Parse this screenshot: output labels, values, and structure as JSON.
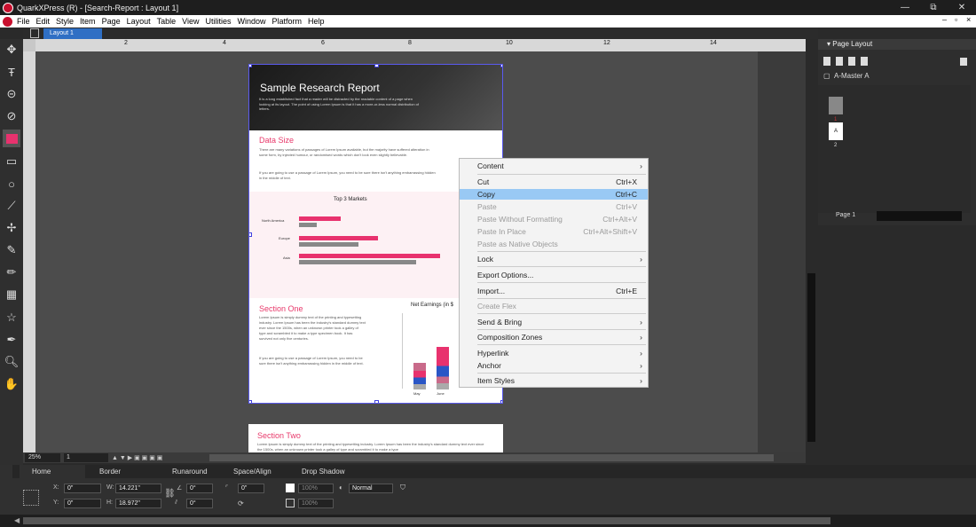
{
  "window": {
    "title": "QuarkXPress (R) - [Search-Report : Layout 1]",
    "minimize": "—",
    "restore": "⧉",
    "close": "✕"
  },
  "menubar": {
    "items": [
      "File",
      "Edit",
      "Style",
      "Item",
      "Page",
      "Layout",
      "Table",
      "View",
      "Utilities",
      "Window",
      "Platform",
      "Help"
    ],
    "doc_minimize": "–",
    "doc_restore": "▫",
    "doc_close": "×"
  },
  "layout_tab": {
    "label": "Layout 1"
  },
  "ruler": {
    "labels": [
      "2",
      "4",
      "6",
      "8",
      "10",
      "12",
      "14"
    ]
  },
  "page": {
    "hero_title": "Sample Research Report",
    "hero_text": "It is a long established fact that a reader will be distracted by the readable content of a page when looking at its layout. The point of using Lorem Ipsum is that it has a more-or-less normal distribution of letters.",
    "data_size_title": "Data Size",
    "data_size_text": "There are many variations of passages of Lorem Ipsum available, but the majority have suffered alteration in some form, by injected humour, or randomised words which don't look even slightly believable.",
    "data_size_text2": "If you are going to use a passage of Lorem Ipsum, you need to be sure there isn't anything embarrassing hidden in the middle of text.",
    "section_one_title": "Section One",
    "section_one_text": "Lorem Ipsum is simply dummy text of the printing and typesetting industry. Lorem Ipsum has been the industry's standard dummy text ever since the 1500s, when an unknown printer took a galley of type and scrambled it to make a type specimen book. It has survived not only five centuries.",
    "section_one_text2": "If you are going to use a passage of Lorem Ipsum, you need to be sure there isn't anything embarrassing hidden in the middle of text.",
    "section_two_title": "Section Two",
    "section_two_text": "Lorem Ipsum is simply dummy text of the printing and typesetting industry. Lorem Ipsum has been the industry's standard dummy text ever since the 1500s, when an unknown printer took a galley of type and scrambled it to make a type"
  },
  "chart_data": [
    {
      "type": "bar",
      "title": "Top 3 Markets",
      "categories": [
        "North America",
        "Europe",
        "Asia"
      ],
      "series": [
        {
          "values": [
            40,
            75,
            135
          ]
        },
        {
          "values": [
            17,
            57,
            112
          ]
        }
      ],
      "colors": [
        "#e8326e",
        "#888888"
      ],
      "orientation": "horizontal"
    },
    {
      "type": "bar",
      "title": "Net Earnings (in $",
      "categories": [
        "May",
        "June"
      ],
      "stacked": true,
      "colors": [
        "#e8326e",
        "#2a56c6",
        "#c96a8a",
        "#aaaaaa"
      ]
    }
  ],
  "context_menu": {
    "items": [
      {
        "label": "Content",
        "shortcut": "",
        "submenu": true,
        "disabled": false
      },
      {
        "label": "Cut",
        "shortcut": "Ctrl+X",
        "submenu": false,
        "disabled": false
      },
      {
        "label": "Copy",
        "shortcut": "Ctrl+C",
        "submenu": false,
        "disabled": false,
        "highlighted": true
      },
      {
        "label": "Paste",
        "shortcut": "Ctrl+V",
        "submenu": false,
        "disabled": true
      },
      {
        "label": "Paste Without Formatting",
        "shortcut": "Ctrl+Alt+V",
        "submenu": false,
        "disabled": true
      },
      {
        "label": "Paste In Place",
        "shortcut": "Ctrl+Alt+Shift+V",
        "submenu": false,
        "disabled": true
      },
      {
        "label": "Paste as Native Objects",
        "shortcut": "",
        "submenu": false,
        "disabled": true
      },
      {
        "label": "Lock",
        "shortcut": "",
        "submenu": true,
        "disabled": false
      },
      {
        "label": "Export Options...",
        "shortcut": "",
        "submenu": false,
        "disabled": false
      },
      {
        "label": "Import...",
        "shortcut": "Ctrl+E",
        "submenu": false,
        "disabled": false
      },
      {
        "label": "Create Flex",
        "shortcut": "",
        "submenu": false,
        "disabled": true
      },
      {
        "label": "Send & Bring",
        "shortcut": "",
        "submenu": true,
        "disabled": false
      },
      {
        "label": "Composition Zones",
        "shortcut": "",
        "submenu": true,
        "disabled": false
      },
      {
        "label": "Hyperlink",
        "shortcut": "",
        "submenu": true,
        "disabled": false
      },
      {
        "label": "Anchor",
        "shortcut": "",
        "submenu": true,
        "disabled": false
      },
      {
        "label": "Item Styles",
        "shortcut": "",
        "submenu": true,
        "disabled": false
      }
    ]
  },
  "page_layout_panel": {
    "title": "Page Layout",
    "master": "A-Master A",
    "page_label": "Page 1",
    "thumb_a": "A",
    "page_numbers": [
      "1",
      "2"
    ]
  },
  "statusbar": {
    "zoom": "25%",
    "page": "1"
  },
  "measurements": {
    "tabs": [
      "Home",
      "Border",
      "Runaround",
      "Space/Align",
      "Drop Shadow"
    ],
    "x_label": "X:",
    "x": "0\"",
    "y_label": "Y:",
    "y": "0\"",
    "w_label": "W:",
    "w": "14.221\"",
    "h_label": "H:",
    "h": "18.972\"",
    "angle": "0°",
    "skew": "0°",
    "corner": "0\"",
    "opacity1": "100%",
    "opacity2": "100%",
    "blend": "Normal",
    "opacity3": "100%"
  }
}
